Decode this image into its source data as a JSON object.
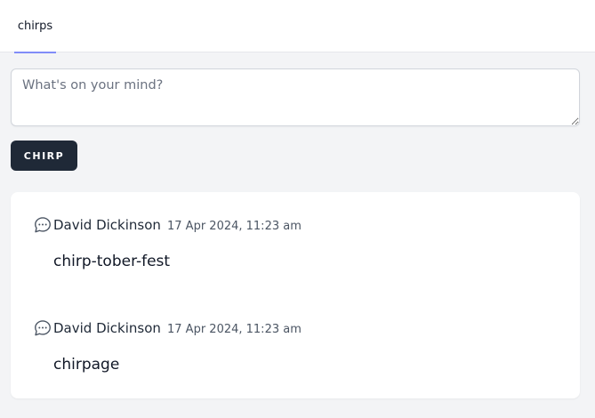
{
  "nav": {
    "tabs": [
      {
        "label": "chirps",
        "active": true
      }
    ],
    "accent_color": "#818cf8"
  },
  "composer": {
    "placeholder": "What's on your mind?",
    "value": ""
  },
  "submit": {
    "label": "CHIRP"
  },
  "chirps": [
    {
      "author": "David Dickinson",
      "date": "17 Apr 2024, 11:23 am",
      "message": "chirp-tober-fest",
      "icon": "chat-bubble-icon"
    },
    {
      "author": "David Dickinson",
      "date": "17 Apr 2024, 11:23 am",
      "message": "chirpage",
      "icon": "chat-bubble-icon"
    }
  ]
}
